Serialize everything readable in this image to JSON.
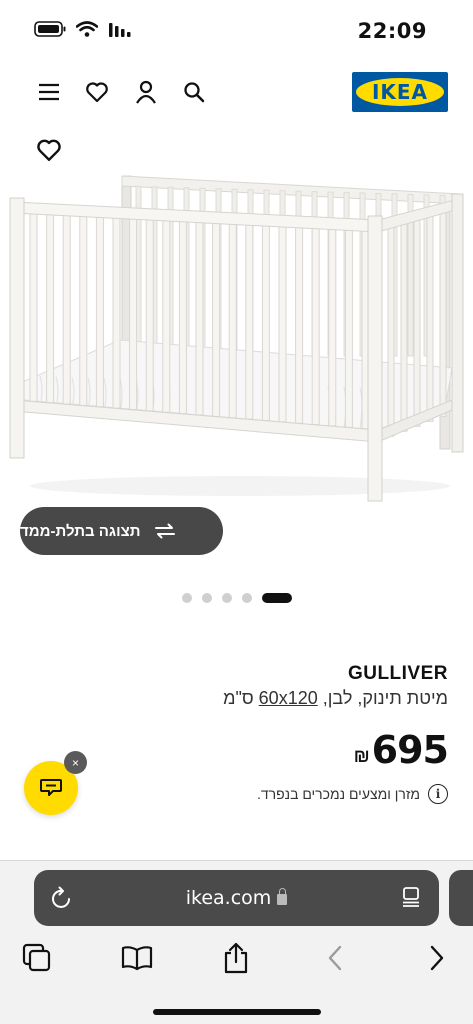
{
  "status_bar": {
    "time": "22:09"
  },
  "header": {
    "logo_text": "IKEA",
    "icons": [
      "menu-icon",
      "heart-icon",
      "user-icon",
      "search-icon"
    ],
    "colors": {
      "logo_blue": "#0058a3",
      "logo_yellow": "#ffdb00"
    }
  },
  "product": {
    "name": "GULLIVER",
    "description_prefix": "מיטת תינוק, לבן, ",
    "size": "60x120",
    "size_unit": " ס\"מ",
    "price_value": "695",
    "currency": "₪",
    "info_text": "מזרן ומצעים נמכרים בנפרד.",
    "view3d_label": "תצוגה בתלת-ממד",
    "gallery": {
      "count": 5,
      "active_index": 4
    }
  },
  "chat": {
    "close_label": "×"
  },
  "browser": {
    "url": "ikea.com",
    "icons": [
      "reload-icon",
      "reader-icon",
      "tabs-icon",
      "bookmarks-icon",
      "share-icon",
      "back-icon",
      "forward-icon"
    ]
  }
}
